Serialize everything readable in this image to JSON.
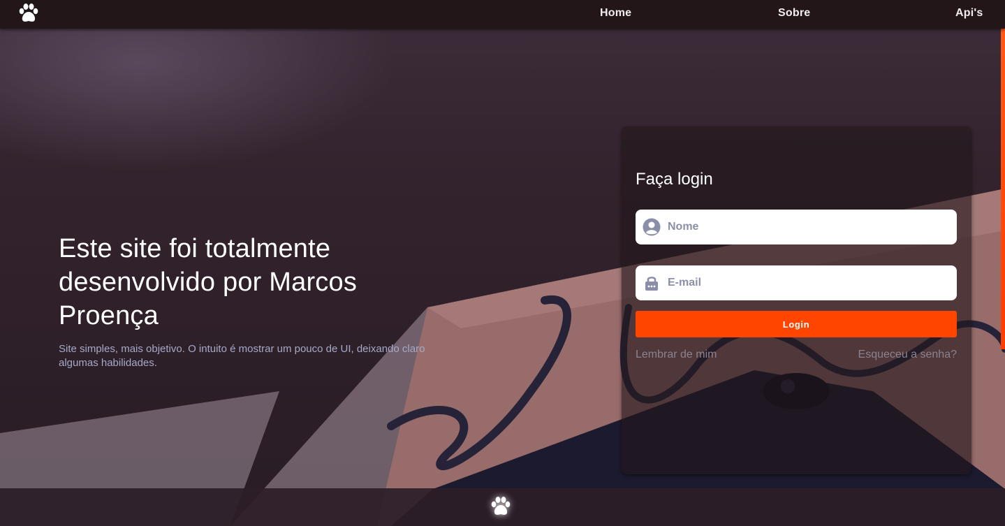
{
  "nav": {
    "logo_icon": "paw-icon",
    "links": [
      {
        "label": "Home"
      },
      {
        "label": "Sobre"
      },
      {
        "label": "Api's"
      }
    ]
  },
  "hero": {
    "title": "Este site foi totalmente desenvolvido por Marcos Proença",
    "subtitle": "Site simples, mais objetivo. O intuito é mostrar um pouco de UI, deixando claro algumas habilidades."
  },
  "login": {
    "title": "Faça login",
    "name_placeholder": "Nome",
    "email_placeholder": "E-mail",
    "button_label": "Login",
    "remember_label": "Lembrar de mim",
    "forgot_label": "Esqueceu a senha?",
    "name_icon": "user-circle-icon",
    "email_icon": "lock-icon"
  },
  "footer": {
    "logo_icon": "paw-icon"
  },
  "colors": {
    "accent": "#ff4500",
    "navbar": "#221619",
    "subtitle": "#a7a9c8"
  }
}
